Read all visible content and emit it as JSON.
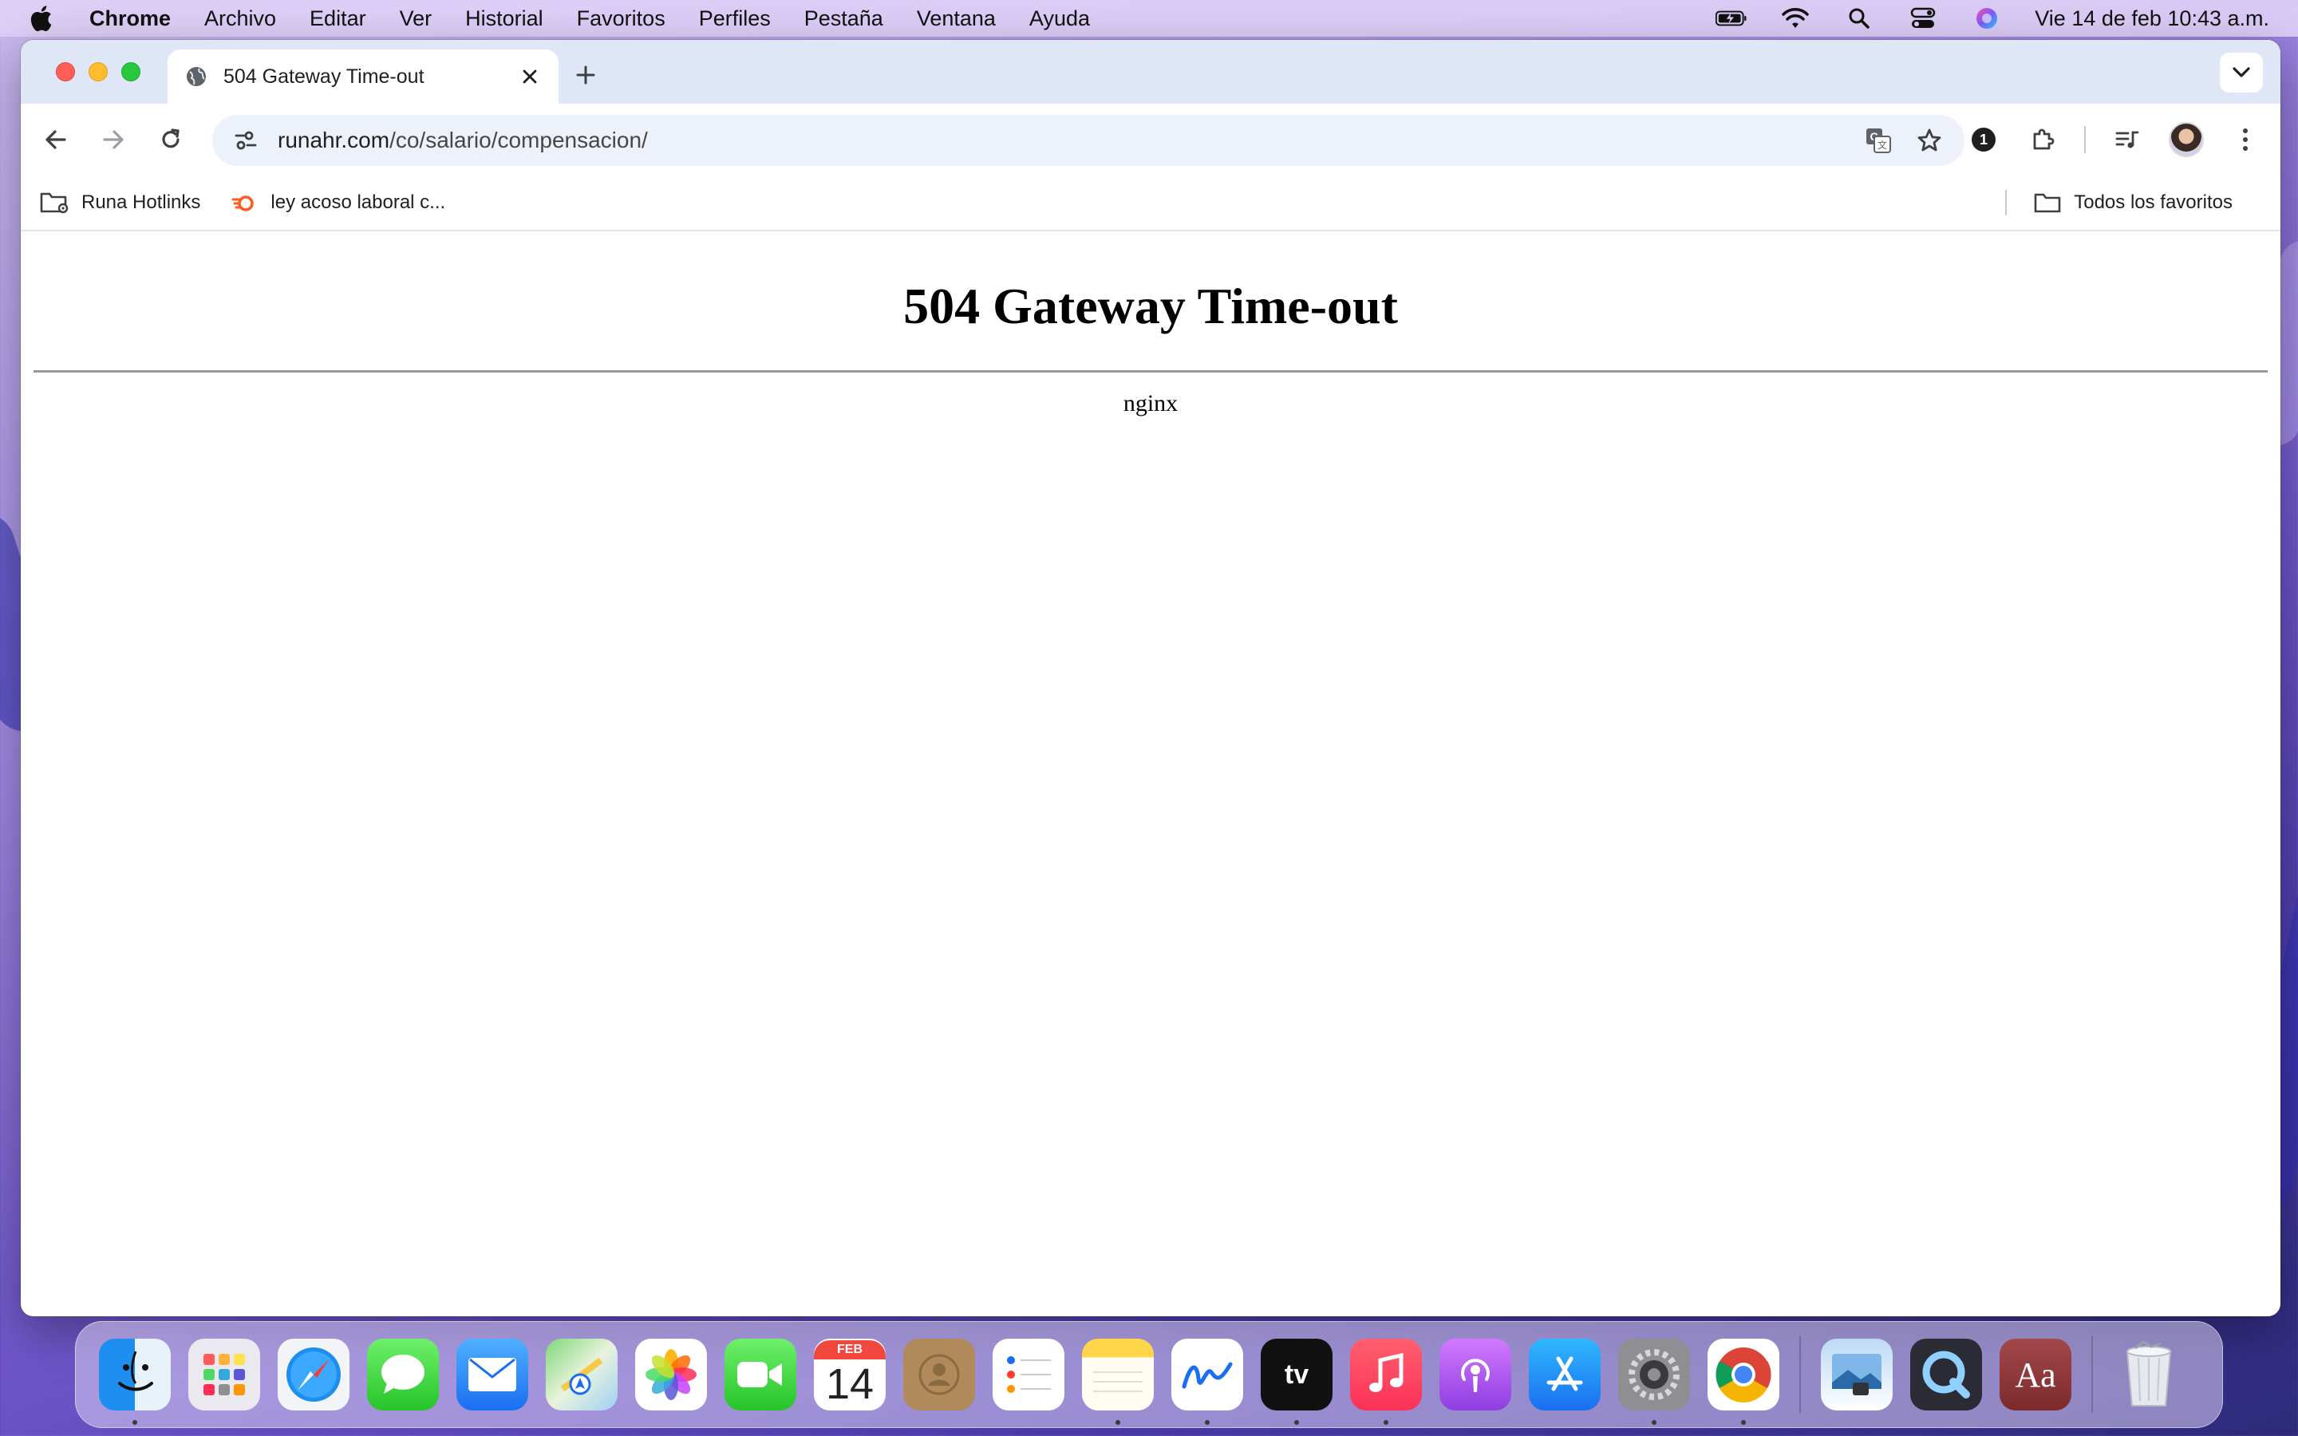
{
  "menubar": {
    "app_name": "Chrome",
    "items": [
      "Archivo",
      "Editar",
      "Ver",
      "Historial",
      "Favoritos",
      "Perfiles",
      "Pestaña",
      "Ventana",
      "Ayuda"
    ],
    "clock": "Vie 14 de feb  10:43 a.m."
  },
  "browser": {
    "tab": {
      "title": "504 Gateway Time-out"
    },
    "omnibox": {
      "host": "runahr.com",
      "path": "/co/salario/compensacion/"
    },
    "extensions_badge": "1",
    "bookmarks": [
      {
        "label": "Runa Hotlinks",
        "icon": "folder-gear-icon"
      },
      {
        "label": "ley acoso laboral c...",
        "icon": "fire-logo-icon"
      }
    ],
    "all_bookmarks_label": "Todos los favoritos"
  },
  "page": {
    "heading": "504 Gateway Time-out",
    "server": "nginx"
  },
  "dock": {
    "calendar_month": "FEB",
    "calendar_day": "14",
    "tv_label": "tv",
    "dictionary_label": "Aa"
  },
  "colors": {
    "menubar_bg": "#ded0f6",
    "tabstrip_bg": "#dfe7f7",
    "omnibox_bg": "#edf2fa",
    "close_red": "#fe5f57",
    "minimize_yellow": "#febc2e",
    "zoom_green": "#28c840"
  }
}
